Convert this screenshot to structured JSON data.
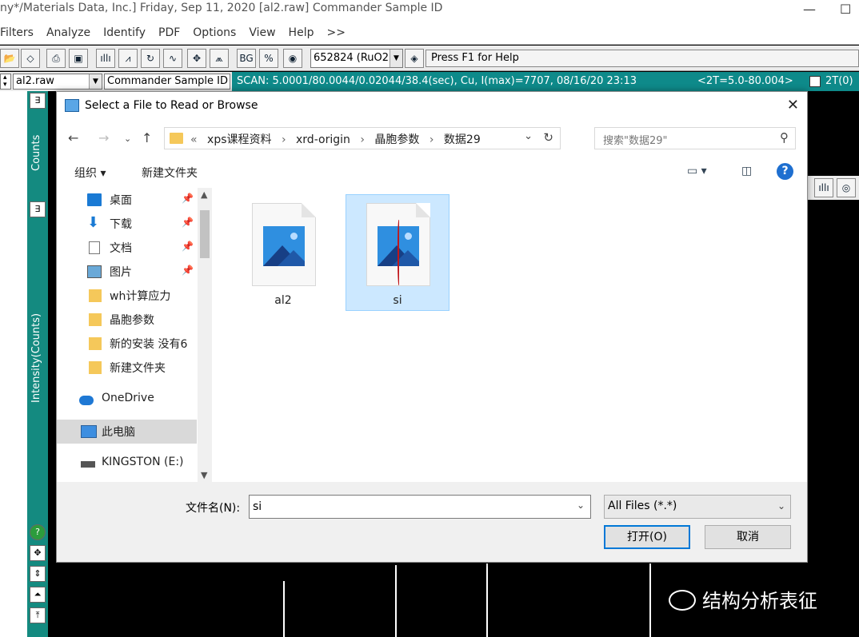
{
  "app": {
    "title": "ny*/Materials Data, Inc.] Friday, Sep 11, 2020 [al2.raw] Commander Sample ID",
    "menu": [
      "Filters",
      "Analyze",
      "Identify",
      "PDF",
      "Options",
      "View",
      "Help",
      ">>"
    ],
    "pdf_combo": "652824 (RuO2",
    "help_text": "Press F1 for Help",
    "file_combo": "al2.raw",
    "sample_combo": "Commander Sample ID",
    "scan_info": "SCAN: 5.0001/80.0044/0.02044/38.4(sec), Cu, I(max)=7707, 08/16/20 23:13",
    "scan_range": "<2T=5.0-80.004>",
    "scan_two": "2T(0)",
    "counts_label": "Counts",
    "intensity_label": "Intensity(Counts)"
  },
  "dialog": {
    "title": "Select a File to Read or Browse",
    "breadcrumbs": [
      "xps课程资料",
      "xrd-origin",
      "晶胞参数",
      "数据29"
    ],
    "search_placeholder": "搜索\"数据29\"",
    "organize": "组织 ▾",
    "new_folder": "新建文件夹",
    "nav_items": [
      {
        "label": "桌面",
        "icon": "desktop-icon",
        "pinned": true
      },
      {
        "label": "下载",
        "icon": "download-icon",
        "pinned": true
      },
      {
        "label": "文档",
        "icon": "document-icon",
        "pinned": true
      },
      {
        "label": "图片",
        "icon": "pictures-icon",
        "pinned": true
      },
      {
        "label": "wh计算应力",
        "icon": "folder-icon",
        "pinned": false
      },
      {
        "label": "晶胞参数",
        "icon": "folder-icon",
        "pinned": false
      },
      {
        "label": "新的安装  没有6",
        "icon": "folder-icon",
        "pinned": false
      },
      {
        "label": "新建文件夹",
        "icon": "folder-icon",
        "pinned": false
      },
      {
        "label": "OneDrive",
        "icon": "cloud-icon",
        "pinned": false
      },
      {
        "label": "此电脑",
        "icon": "computer-icon",
        "pinned": false
      },
      {
        "label": "KINGSTON (E:)",
        "icon": "drive-icon",
        "pinned": false
      }
    ],
    "files": [
      {
        "name": "al2",
        "selected": false
      },
      {
        "name": "si",
        "selected": true
      }
    ],
    "filename_label": "文件名(N):",
    "filename_value": "si",
    "filter_value": "All Files (*.*)",
    "open_button": "打开(O)",
    "cancel_button": "取消"
  },
  "watermark": "结构分析表征",
  "colors": {
    "scan_bar": "#0e8a8a",
    "strip": "#148a80",
    "selection": "#cce8ff",
    "accent": "#0078d7"
  }
}
